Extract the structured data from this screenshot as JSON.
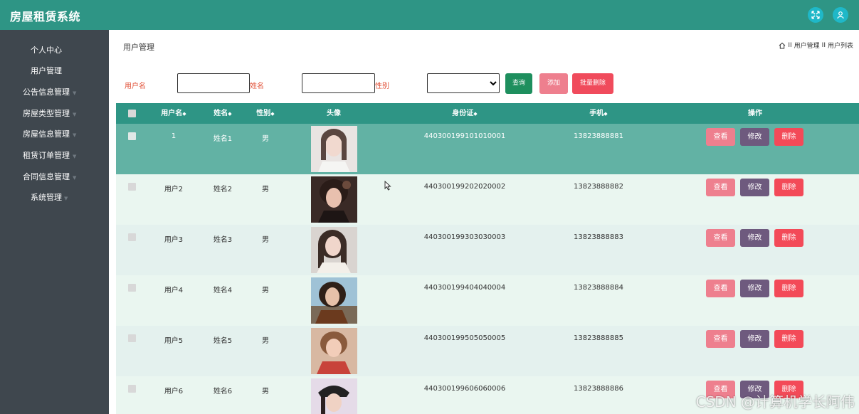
{
  "app": {
    "title": "房屋租赁系统"
  },
  "header": {
    "icons": [
      "fullscreen-icon",
      "user-icon"
    ],
    "accent": "#2e9585",
    "icon_bg": "#1fb8c8"
  },
  "sidebar": {
    "items": [
      {
        "label": "个人中心"
      },
      {
        "label": "用户管理"
      },
      {
        "label": "公告信息管理"
      },
      {
        "label": "房屋类型管理"
      },
      {
        "label": "房屋信息管理"
      },
      {
        "label": "租赁订单管理"
      },
      {
        "label": "合同信息管理"
      },
      {
        "label": "系统管理"
      }
    ]
  },
  "page": {
    "title": "用户管理",
    "breadcrumb": [
      "用户管理",
      "用户列表"
    ],
    "breadcrumb_sep": "II"
  },
  "search": {
    "username_label": "用户名",
    "username_value": "",
    "name_label": "姓名",
    "name_value": "",
    "gender_label": "性别",
    "gender_value": "",
    "query_label": "查询",
    "add_label": "添加",
    "batch_delete_label": "批量删除"
  },
  "table": {
    "columns": [
      "用户名",
      "姓名",
      "性别",
      "头像",
      "身份证",
      "手机",
      "操作"
    ],
    "sort_arrow": "◆",
    "rows": [
      {
        "username": "1",
        "name": "姓名1",
        "gender": "男",
        "id_card": "440300199101010001",
        "phone": "13823888881"
      },
      {
        "username": "用户2",
        "name": "姓名2",
        "gender": "男",
        "id_card": "440300199202020002",
        "phone": "13823888882"
      },
      {
        "username": "用户3",
        "name": "姓名3",
        "gender": "男",
        "id_card": "440300199303030003",
        "phone": "13823888883"
      },
      {
        "username": "用户4",
        "name": "姓名4",
        "gender": "男",
        "id_card": "440300199404040004",
        "phone": "13823888884"
      },
      {
        "username": "用户5",
        "name": "姓名5",
        "gender": "男",
        "id_card": "440300199505050005",
        "phone": "13823888885"
      },
      {
        "username": "用户6",
        "name": "姓名6",
        "gender": "男",
        "id_card": "440300199606060006",
        "phone": "13823888886"
      }
    ],
    "actions": {
      "view": "查看",
      "edit": "修改",
      "delete": "删除"
    }
  },
  "watermark": "CSDN @计算机学长阿伟",
  "colors": {
    "sidebar": "#3f474e",
    "header_row": "#2e9585",
    "selected_row": "#62b2a4",
    "row_a": "#eaf6f0",
    "row_b": "#e4f1ee",
    "query_btn": "#1e8f5e",
    "add_btn": "#ee7f8e",
    "batch_delete_btn": "#f04b5c",
    "view_btn": "#ee7f8e",
    "edit_btn": "#6e5a7e",
    "delete_btn": "#f34a58"
  }
}
